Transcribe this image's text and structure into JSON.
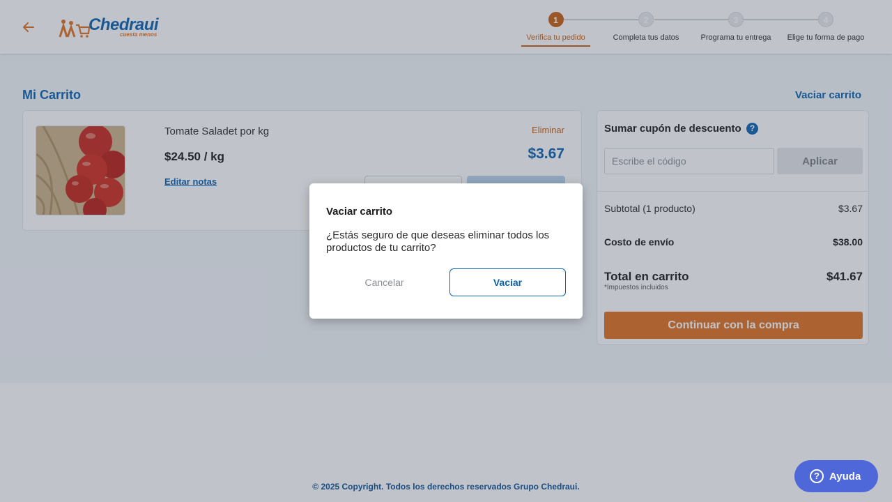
{
  "header": {
    "brand_name": "Chedraui",
    "brand_tagline": "cuesta menos",
    "steps": [
      {
        "number": "1",
        "label": "Verifica tu pedido",
        "active": true
      },
      {
        "number": "2",
        "label": "Completa tus datos",
        "active": false
      },
      {
        "number": "3",
        "label": "Programa tu entrega",
        "active": false
      },
      {
        "number": "4",
        "label": "Elige tu forma de pago",
        "active": false
      }
    ]
  },
  "cart": {
    "title": "Mi Carrito",
    "clear_link": "Vaciar carrito",
    "items": [
      {
        "name": "Tomate Saladet por kg",
        "unit_price": "$24.50 / kg",
        "edit_notes": "Editar notas",
        "delete": "Eliminar",
        "line_total": "$3.67"
      }
    ]
  },
  "summary": {
    "coupon_title": "Sumar cupón de descuento",
    "coupon_placeholder": "Escribe el código",
    "coupon_button": "Aplicar",
    "subtotal_label": "Subtotal (1 producto)",
    "subtotal_value": "$3.67",
    "shipping_label": "Costo de envío",
    "shipping_value": "$38.00",
    "total_label": "Total en carrito",
    "total_value": "$41.67",
    "tax_note": "*Impuestos incluidos",
    "continue_button": "Continuar con la compra"
  },
  "modal": {
    "title": "Vaciar carrito",
    "message": "¿Estás seguro de que deseas eliminar todos los productos de tu carrito?",
    "cancel": "Cancelar",
    "confirm": "Vaciar"
  },
  "footer": {
    "copyright": "© 2025 Copyright. Todos los derechos reservados Grupo Chedraui."
  },
  "help_button": "Ayuda",
  "colors": {
    "brand_blue": "#0b60b0",
    "brand_orange": "#e2701e"
  }
}
